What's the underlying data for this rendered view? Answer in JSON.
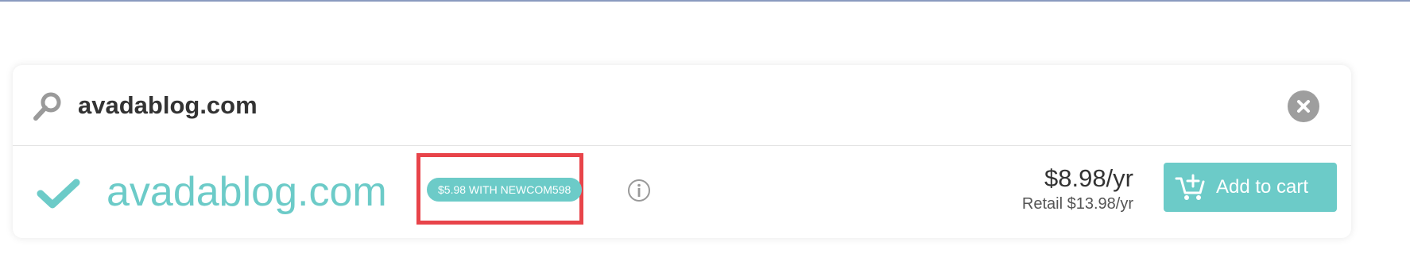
{
  "search": {
    "value": "avadablog.com",
    "icon": "search-icon",
    "clear_icon": "close-icon"
  },
  "result": {
    "status_icon": "checkmark-icon",
    "domain": "avadablog.com",
    "promo_badge": "$5.98 WITH NEWCOM598",
    "info_icon": "info-icon",
    "price": "$8.98/yr",
    "retail_price": "Retail $13.98/yr",
    "add_to_cart_label": "Add to cart",
    "cart_icon": "cart-add-icon"
  },
  "colors": {
    "accent": "#6ccbc8",
    "highlight": "#e8444a",
    "text": "#333333"
  }
}
